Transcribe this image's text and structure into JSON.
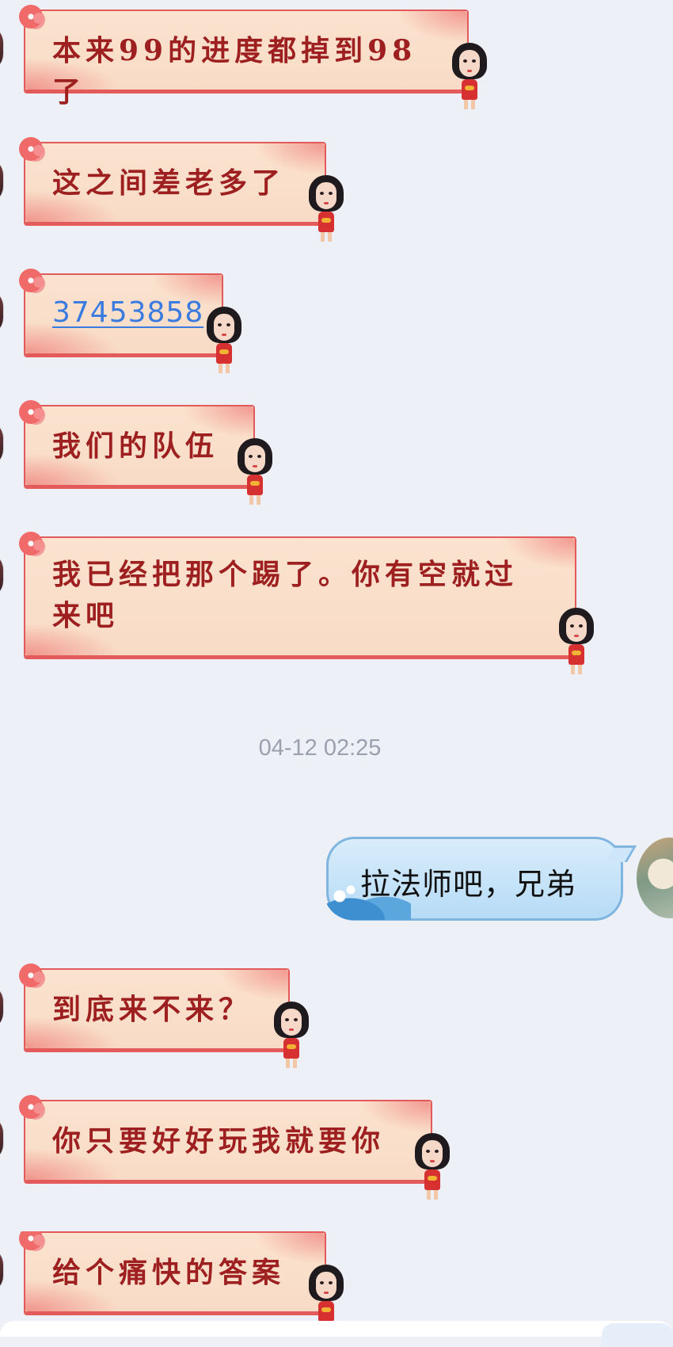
{
  "messages": [
    {
      "side": "in",
      "text": "本来99的进度都掉到98了"
    },
    {
      "side": "in",
      "text": "这之间差老多了"
    },
    {
      "side": "in",
      "text": "37453858",
      "is_link": true
    },
    {
      "side": "in",
      "text": "我们的队伍"
    },
    {
      "side": "in",
      "text": "我已经把那个踢了。你有空就过来吧"
    },
    {
      "side": "time",
      "text": "04-12 02:25"
    },
    {
      "side": "out",
      "text": "拉法师吧，兄弟"
    },
    {
      "side": "in",
      "text": "到底来不来？"
    },
    {
      "side": "in",
      "text": "你只要好好玩我就要你"
    },
    {
      "side": "in",
      "text": "给个痛快的答案"
    }
  ],
  "colors": {
    "background": "#eef0f7",
    "incoming_text": "#9e1f1f",
    "incoming_bubble": "#f8dbc6",
    "incoming_border": "#e25a5a",
    "link": "#3a7be0",
    "outgoing_bubble": "#c7e3f8",
    "timestamp": "#9aa0ad"
  }
}
